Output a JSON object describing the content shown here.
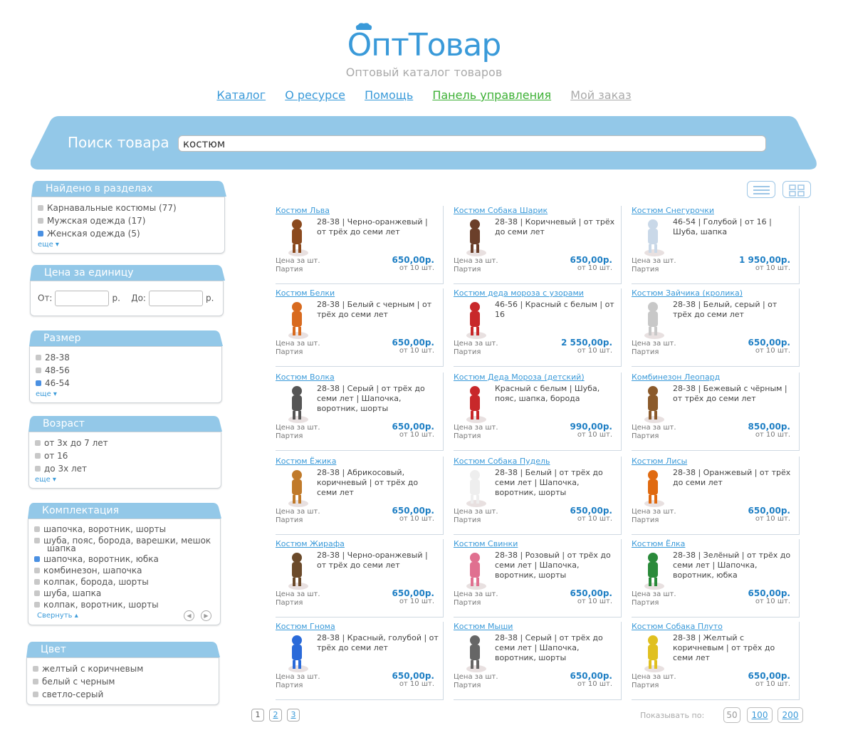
{
  "header": {
    "logo_text": "ОптТовар",
    "tagline": "Оптовый каталог товаров"
  },
  "nav": {
    "catalog": "Каталог",
    "about": "О ресурсе",
    "help": "Помощь",
    "control_panel": "Панель управления",
    "my_order": "Мой заказ"
  },
  "search": {
    "label": "Поиск товара",
    "value": "костюм"
  },
  "sections_panel": {
    "title": "Найдено в разделах",
    "items": [
      "Карнавальные костюмы (77)",
      "Мужская одежда (17)",
      "Женская одежда (5)"
    ],
    "more": "еще ▾"
  },
  "price_panel": {
    "title": "Цена за единицу",
    "from_label": "От:",
    "to_label": "До:",
    "currency": "р."
  },
  "size_panel": {
    "title": "Размер",
    "items": [
      "28-38",
      "48-56",
      "46-54"
    ],
    "more": "еще ▾"
  },
  "age_panel": {
    "title": "Возраст",
    "items": [
      "от 3х до 7 лет",
      "от 16",
      "до 3х лет"
    ],
    "more": "еще ▾"
  },
  "kit_panel": {
    "title": "Комплектация",
    "items": [
      "шапочка, воротник, шорты",
      "шуба, пояс, борода, варешки, мешок",
      "шапка",
      "шапочка, воротник, юбка",
      "комбинезон, шапочка",
      "колпак, борода, шорты",
      "шуба, шапка",
      "колпак, воротник, шорты"
    ],
    "collapse": "Свернуть ▴",
    "prev_icon": "◀",
    "next_icon": "▶"
  },
  "color_panel": {
    "title": "Цвет",
    "items": [
      "желтый с коричневым",
      "белый с черным",
      "светло-серый"
    ]
  },
  "price_labels": {
    "unit": "Цена за шт.",
    "batch": "Партия"
  },
  "products": [
    {
      "title": "Костюм Льва",
      "desc": "28-38 | Черно-оранжевый | от трёх до семи лет",
      "price": "650,00р.",
      "batch": "от 10 шт."
    },
    {
      "title": "Костюм Собака Шарик",
      "desc": "28-38 | Коричневый | от трёх до семи лет",
      "price": "650,00р.",
      "batch": "от 10 шт."
    },
    {
      "title": "Костюм Снегурочки",
      "desc": "46-54 | Голубой | от 16 | Шуба, шапка",
      "price": "1 950,00р.",
      "batch": "от 10 шт."
    },
    {
      "title": "Костюм Белки",
      "desc": "28-38 | Белый с черным | от трёх до семи лет",
      "price": "650,00р.",
      "batch": "от 10 шт."
    },
    {
      "title": "Костюм деда мороза с узорами",
      "desc": "46-56 | Красный с белым | от 16",
      "price": "2 550,00р.",
      "batch": "от 10 шт."
    },
    {
      "title": "Костюм Зайчика (кролика)",
      "desc": "28-38 | Белый, серый | от трёх до семи лет",
      "price": "650,00р.",
      "batch": "от 10 шт."
    },
    {
      "title": "Костюм Волка",
      "desc": "28-38 | Серый | от трёх до семи лет | Шапочка, воротник, шорты",
      "price": "650,00р.",
      "batch": "от 10 шт."
    },
    {
      "title": "Костюм Деда Мороза (детский)",
      "desc": "Красный с белым | Шуба, пояс, шапка, борода",
      "price": "990,00р.",
      "batch": "от 10 шт."
    },
    {
      "title": "Комбинезон Леопард",
      "desc": "28-38 | Бежевый с чёрным | от трёх до семи лет",
      "price": "850,00р.",
      "batch": "от 10 шт."
    },
    {
      "title": "Костюм Ёжика",
      "desc": "28-38 | Абрикосовый, коричневый | от трёх до семи лет",
      "price": "650,00р.",
      "batch": "от 10 шт."
    },
    {
      "title": "Костюм Собака Пудель",
      "desc": "28-38 | Белый | от трёх до семи лет | Шапочка, воротник, шорты",
      "price": "650,00р.",
      "batch": "от 10 шт."
    },
    {
      "title": "Костюм Лисы",
      "desc": "28-38 | Оранжевый | от трёх до семи лет",
      "price": "650,00р.",
      "batch": "от 10 шт."
    },
    {
      "title": "Костюм Жирафа",
      "desc": "28-38 | Черно-оранжевый | от трёх до семи лет",
      "price": "650,00р.",
      "batch": "от 10 шт."
    },
    {
      "title": "Костюм Свинки",
      "desc": "28-38 | Розовый | от трёх до семи лет | Шапочка, воротник, шорты",
      "price": "650,00р.",
      "batch": "от 10 шт."
    },
    {
      "title": "Костюм Ёлка",
      "desc": "28-38 | Зелёный | от трёх до семи лет | Шапочка, воротник, юбка",
      "price": "650,00р.",
      "batch": "от 10 шт."
    },
    {
      "title": "Костюм Гнома",
      "desc": "28-38 | Красный, голубой | от трёх до семи лет",
      "price": "650,00р.",
      "batch": "от 10 шт."
    },
    {
      "title": "Костюм Мыши",
      "desc": "28-38 | Серый | от трёх до семи лет | Шапочка, воротник, шорты",
      "price": "650,00р.",
      "batch": "от 10 шт."
    },
    {
      "title": "Костюм Собака Плуто",
      "desc": "28-38 | Желтый с коричневым | от трёх до семи лет",
      "price": "650,00р.",
      "batch": "от 10 шт."
    }
  ],
  "pagination": {
    "pages": [
      "1",
      "2",
      "3"
    ],
    "show_label": "Показывать по:",
    "page_sizes": [
      "50",
      "100",
      "200"
    ]
  },
  "colors": {
    "accent": "#3a9ad9",
    "band": "#93c8e8",
    "green": "#3cb034",
    "price": "#1f7fc4"
  }
}
